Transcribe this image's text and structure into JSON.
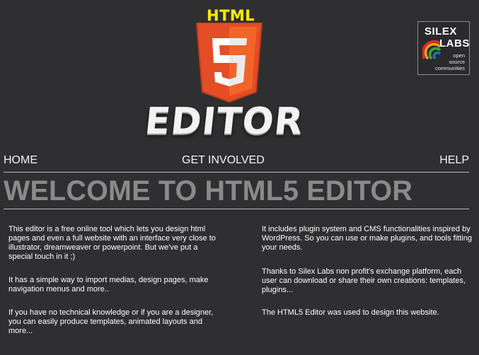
{
  "logo": {
    "top_text": "HTML",
    "shield_number": "5",
    "bottom_text": "EDITOR",
    "colors": {
      "top_text": "#ffea00",
      "shield_outer": "#e44d26",
      "shield_inner": "#f16529",
      "number": "#ffffff"
    }
  },
  "badge": {
    "title_line1": "SILEX",
    "title_line2": "LABS",
    "tagline": [
      "open",
      "source",
      "communities"
    ],
    "arc_colors": [
      "#e8262a",
      "#f6a21b",
      "#37a838",
      "#1b74bb"
    ]
  },
  "nav": {
    "home": "HOME",
    "get_involved": "GET INVOLVED",
    "help": "HELP"
  },
  "welcome": {
    "title": "WELCOME TO HTML5 EDITOR"
  },
  "content": {
    "left": [
      "This editor is a free online tool which lets you design html pages and even a full website with an interface very close to illustrator, dreamweaver or powerpoint. But we've put a special touch in it ;)",
      "It has a simple way to import medias, design pages, make navigation menus and more..",
      "If you have no technical knowledge or if you are a designer, you can easily produce templates, animated layouts and more..."
    ],
    "right": [
      "It includes plugin system and CMS functionalities inspired by WordPress. So you can use or make plugins, and tools fitting your needs.",
      "Thanks to Silex Labs non profit's exchange platform, each user can download or share their own creations: templates, plugins...",
      "The HTML5 Editor was used to design this website."
    ]
  }
}
